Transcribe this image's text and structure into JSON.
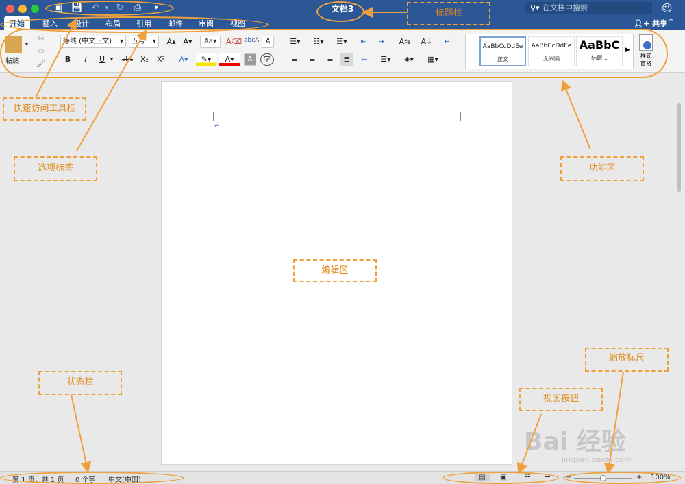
{
  "window": {
    "title": "文档3"
  },
  "search": {
    "placeholder": "在文档中搜索"
  },
  "tabs": [
    "开始",
    "插入",
    "设计",
    "布局",
    "引用",
    "邮件",
    "审阅",
    "视图"
  ],
  "share_label": "共享",
  "ribbon": {
    "paste_label": "粘贴",
    "font_name": "等线 (中文正文)",
    "font_size": "五号",
    "bold": "B",
    "italic": "I",
    "underline": "U",
    "strike": "abc",
    "subscript": "X₂",
    "superscript": "X²",
    "styles": [
      {
        "sample": "AaBbCcDdEe",
        "name": "正文"
      },
      {
        "sample": "AaBbCcDdEe",
        "name": "无间隔"
      },
      {
        "sample": "AaBbC",
        "name": "标题 1"
      }
    ],
    "styles_pane_label": "样式\n窗格"
  },
  "status": {
    "page": "第 1 页，共 1 页",
    "words": "0 个字",
    "lang": "中文(中国)",
    "zoom": "100%"
  },
  "zoom_level": 1.0,
  "annotations": {
    "title_bar": "标题栏",
    "quick_access": "快速访问工具栏",
    "tabs": "选项标签",
    "ribbon": "功能区",
    "edit_area": "编辑区",
    "status_bar": "状态栏",
    "view_buttons": "视图按钮",
    "zoom_slider": "缩放标尺"
  },
  "watermark": {
    "main": "Bai 经验",
    "sub": "jingyan.baidu.com"
  },
  "colors": {
    "title_bg": "#2b5797",
    "annotation": "#f0a03a"
  }
}
